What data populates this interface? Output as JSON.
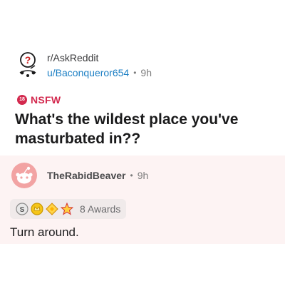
{
  "post": {
    "subreddit": "r/AskReddit",
    "author": "u/Baconqueror654",
    "time": "9h",
    "separator": "•",
    "nsfw_badge": "18",
    "nsfw_label": "NSFW",
    "title": "What's the wildest place you've masturbated in??"
  },
  "comment": {
    "author": "TheRabidBeaver",
    "separator": "•",
    "time": "9h",
    "awards": {
      "icons": [
        "silver-award-icon",
        "gold-award-icon",
        "helpful-award-icon",
        "wholesome-award-icon"
      ],
      "count_label": "8 Awards"
    },
    "body": "Turn around."
  },
  "colors": {
    "nsfw": "#d3294e",
    "user_link": "#1c7fc4",
    "comment_bg": "#fdf3f3",
    "snoo_avatar": "#f2a3a3"
  }
}
